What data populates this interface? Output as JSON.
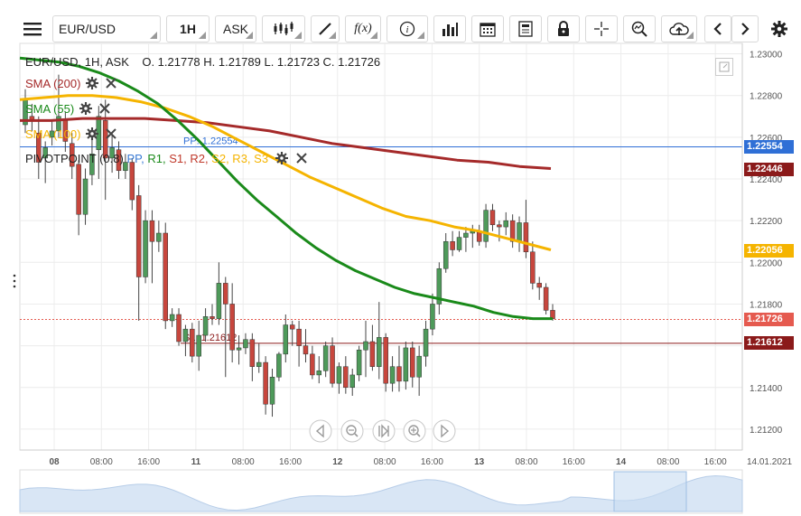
{
  "toolbar": {
    "symbol": "EUR/USD",
    "interval": "1H",
    "price_type": "ASK",
    "icons": [
      "menu-icon",
      "candles-icon",
      "draw-icon",
      "fx-icon",
      "info-icon",
      "bars-icon",
      "calendar-icon",
      "news-icon",
      "lock-icon",
      "crosshair-icon",
      "zoom-icon",
      "cloud-upload-icon",
      "chevron-left-icon",
      "chevron-right-icon",
      "gear-icon"
    ],
    "fx_label": "f(x)"
  },
  "header": {
    "title": "EUR/USD, 1H, ASK",
    "ohlc": "O. 1.21778 H. 1.21789 L. 1.21723 C. 1.21726"
  },
  "indicators": [
    {
      "label": "SMA (200)",
      "color": "#a52a2a"
    },
    {
      "label": "SMA (55)",
      "color": "#1a8a1a"
    },
    {
      "label": "SMA (100)",
      "color": "#f5b400"
    }
  ],
  "pivot": {
    "label": "PIVOTPOINT (0.8)",
    "parts": [
      {
        "text": "PP,",
        "color": "#3a7bd5"
      },
      {
        "text": "R1,",
        "color": "#1a8a1a"
      },
      {
        "text": "S1,",
        "color": "#c0392b"
      },
      {
        "text": "R2,",
        "color": "#c0392b"
      },
      {
        "text": "S2,",
        "color": "#f5b400"
      },
      {
        "text": "R3,",
        "color": "#f5b400"
      },
      {
        "text": "S3",
        "color": "#f5b400"
      }
    ],
    "pp_line": "PP: 1.22554",
    "s1_line": "S1: 1.21612"
  },
  "price_axis": {
    "ticks": [
      "1.23000",
      "1.22800",
      "1.22600",
      "1.22400",
      "1.22200",
      "1.22000",
      "1.21800",
      "1.21600",
      "1.21400",
      "1.21200"
    ],
    "tags": [
      {
        "value": "1.22554",
        "color": "#2f6fd6"
      },
      {
        "value": "1.22446",
        "color": "#8b1a1a"
      },
      {
        "value": "1.22056",
        "color": "#f5b400"
      },
      {
        "value": "1.21726",
        "color": "#e55a4f"
      },
      {
        "value": "1.21612",
        "color": "#8b1a1a"
      }
    ]
  },
  "time_axis": {
    "labels": [
      {
        "text": "08",
        "bold": true
      },
      {
        "text": "08:00",
        "bold": false
      },
      {
        "text": "16:00",
        "bold": false
      },
      {
        "text": "11",
        "bold": true
      },
      {
        "text": "08:00",
        "bold": false
      },
      {
        "text": "16:00",
        "bold": false
      },
      {
        "text": "12",
        "bold": true
      },
      {
        "text": "08:00",
        "bold": false
      },
      {
        "text": "16:00",
        "bold": false
      },
      {
        "text": "13",
        "bold": true
      },
      {
        "text": "08:00",
        "bold": false
      },
      {
        "text": "16:00",
        "bold": false
      },
      {
        "text": "14",
        "bold": true
      },
      {
        "text": "08:00",
        "bold": false
      },
      {
        "text": "16:00",
        "bold": false
      },
      {
        "text": "14.01.2021",
        "bold": false
      }
    ]
  },
  "nav_controls": [
    "scroll-left-icon",
    "zoom-out-icon",
    "reset-icon",
    "zoom-in-icon",
    "scroll-right-icon"
  ],
  "chart_data": {
    "type": "candlestick",
    "ylim": [
      1.211,
      1.2305
    ],
    "candles": [
      [
        1.2266,
        1.2283,
        1.2262,
        1.2278
      ],
      [
        1.227,
        1.2276,
        1.2263,
        1.2268
      ],
      [
        1.2262,
        1.227,
        1.224,
        1.2248
      ],
      [
        1.225,
        1.2258,
        1.2238,
        1.2255
      ],
      [
        1.226,
        1.2268,
        1.2256,
        1.2263
      ],
      [
        1.2263,
        1.229,
        1.226,
        1.227
      ],
      [
        1.2268,
        1.2272,
        1.2253,
        1.2258
      ],
      [
        1.2257,
        1.2262,
        1.224,
        1.2246
      ],
      [
        1.2247,
        1.2249,
        1.2213,
        1.2223
      ],
      [
        1.2223,
        1.2245,
        1.2218,
        1.224
      ],
      [
        1.2242,
        1.2262,
        1.2237,
        1.2252
      ],
      [
        1.2254,
        1.2275,
        1.224,
        1.227
      ],
      [
        1.2268,
        1.2278,
        1.223,
        1.225
      ],
      [
        1.225,
        1.2262,
        1.2243,
        1.2255
      ],
      [
        1.2254,
        1.2258,
        1.224,
        1.2244
      ],
      [
        1.2244,
        1.2252,
        1.224,
        1.2248
      ],
      [
        1.2248,
        1.225,
        1.2225,
        1.223
      ],
      [
        1.2232,
        1.2237,
        1.2172,
        1.2193
      ],
      [
        1.2193,
        1.2225,
        1.219,
        1.222
      ],
      [
        1.222,
        1.2225,
        1.219,
        1.221
      ],
      [
        1.221,
        1.222,
        1.2205,
        1.2214
      ],
      [
        1.2214,
        1.2219,
        1.2168,
        1.2172
      ],
      [
        1.2172,
        1.2178,
        1.2169,
        1.2175
      ],
      [
        1.2175,
        1.2178,
        1.216,
        1.2162
      ],
      [
        1.2162,
        1.217,
        1.2155,
        1.2168
      ],
      [
        1.2168,
        1.2171,
        1.2152,
        1.2155
      ],
      [
        1.2155,
        1.2172,
        1.2148,
        1.2165
      ],
      [
        1.2165,
        1.2178,
        1.2162,
        1.2174
      ],
      [
        1.2174,
        1.218,
        1.217,
        1.2173
      ],
      [
        1.2173,
        1.22,
        1.217,
        1.219
      ],
      [
        1.219,
        1.2193,
        1.2145,
        1.218
      ],
      [
        1.218,
        1.219,
        1.2152,
        1.2158
      ],
      [
        1.2158,
        1.2165,
        1.2151,
        1.2159
      ],
      [
        1.2159,
        1.2166,
        1.2156,
        1.2163
      ],
      [
        1.2163,
        1.2166,
        1.2143,
        1.215
      ],
      [
        1.215,
        1.2161,
        1.2147,
        1.2152
      ],
      [
        1.2152,
        1.2155,
        1.2127,
        1.2132
      ],
      [
        1.2132,
        1.2149,
        1.2126,
        1.2145
      ],
      [
        1.2145,
        1.2157,
        1.2143,
        1.2156
      ],
      [
        1.2156,
        1.2175,
        1.2152,
        1.217
      ],
      [
        1.217,
        1.2172,
        1.216,
        1.2168
      ],
      [
        1.2168,
        1.2172,
        1.215,
        1.216
      ],
      [
        1.216,
        1.2168,
        1.2152,
        1.2156
      ],
      [
        1.2156,
        1.216,
        1.2144,
        1.2146
      ],
      [
        1.2146,
        1.2155,
        1.2142,
        1.2148
      ],
      [
        1.2148,
        1.2162,
        1.2145,
        1.216
      ],
      [
        1.216,
        1.2164,
        1.214,
        1.2142
      ],
      [
        1.2142,
        1.2152,
        1.2137,
        1.215
      ],
      [
        1.215,
        1.2155,
        1.2137,
        1.214
      ],
      [
        1.214,
        1.2149,
        1.2136,
        1.2146
      ],
      [
        1.2146,
        1.216,
        1.2143,
        1.2158
      ],
      [
        1.2158,
        1.2172,
        1.2145,
        1.2162
      ],
      [
        1.2162,
        1.217,
        1.2148,
        1.215
      ],
      [
        1.215,
        1.2181,
        1.2144,
        1.2164
      ],
      [
        1.2164,
        1.2166,
        1.2138,
        1.2142
      ],
      [
        1.2142,
        1.2155,
        1.2138,
        1.215
      ],
      [
        1.215,
        1.216,
        1.2138,
        1.2143
      ],
      [
        1.2143,
        1.2162,
        1.2139,
        1.2159
      ],
      [
        1.2159,
        1.2162,
        1.214,
        1.2145
      ],
      [
        1.2145,
        1.216,
        1.2136,
        1.2155
      ],
      [
        1.2155,
        1.2172,
        1.215,
        1.2168
      ],
      [
        1.2168,
        1.2185,
        1.2165,
        1.218
      ],
      [
        1.218,
        1.22,
        1.2175,
        1.2197
      ],
      [
        1.2197,
        1.2214,
        1.2195,
        1.221
      ],
      [
        1.221,
        1.2215,
        1.2203,
        1.2206
      ],
      [
        1.2206,
        1.2215,
        1.2205,
        1.2212
      ],
      [
        1.2212,
        1.2217,
        1.2205,
        1.2214
      ],
      [
        1.2214,
        1.2218,
        1.2207,
        1.2215
      ],
      [
        1.2215,
        1.2218,
        1.2208,
        1.221
      ],
      [
        1.221,
        1.2228,
        1.2207,
        1.2225
      ],
      [
        1.2225,
        1.2228,
        1.2215,
        1.2218
      ],
      [
        1.2218,
        1.222,
        1.221,
        1.2217
      ],
      [
        1.2217,
        1.2224,
        1.2213,
        1.222
      ],
      [
        1.222,
        1.2223,
        1.2207,
        1.221
      ],
      [
        1.221,
        1.2222,
        1.2205,
        1.2219
      ],
      [
        1.2219,
        1.223,
        1.2202,
        1.2205
      ],
      [
        1.2205,
        1.221,
        1.2187,
        1.219
      ],
      [
        1.219,
        1.2193,
        1.2182,
        1.2188
      ],
      [
        1.2188,
        1.219,
        1.2175,
        1.2177
      ],
      [
        1.2177,
        1.218,
        1.2172,
        1.2173
      ]
    ],
    "sma55": [
      1.2298,
      1.2297,
      1.2296,
      1.2294,
      1.2291,
      1.2287,
      1.2282,
      1.2276,
      1.2268,
      1.2259,
      1.2249,
      1.2239,
      1.223,
      1.2222,
      1.2214,
      1.2207,
      1.2201,
      1.2196,
      1.2192,
      1.2188,
      1.2185,
      1.2183,
      1.2181,
      1.2179,
      1.2176,
      1.2174,
      1.2173,
      1.2173
    ],
    "sma100": [
      1.2278,
      1.2279,
      1.228,
      1.228,
      1.2279,
      1.2277,
      1.2274,
      1.227,
      1.2265,
      1.2259,
      1.2253,
      1.2247,
      1.2241,
      1.2236,
      1.2231,
      1.2226,
      1.2222,
      1.222,
      1.2217,
      1.2215,
      1.2212,
      1.2209,
      1.2206
    ],
    "sma200": [
      1.2268,
      1.2268,
      1.2269,
      1.2269,
      1.2269,
      1.2268,
      1.2267,
      1.2265,
      1.2263,
      1.226,
      1.2257,
      1.2255,
      1.2253,
      1.2251,
      1.2249,
      1.2248,
      1.2246,
      1.2245
    ],
    "pp": 1.22554,
    "s1": 1.21612,
    "last": 1.21726
  }
}
